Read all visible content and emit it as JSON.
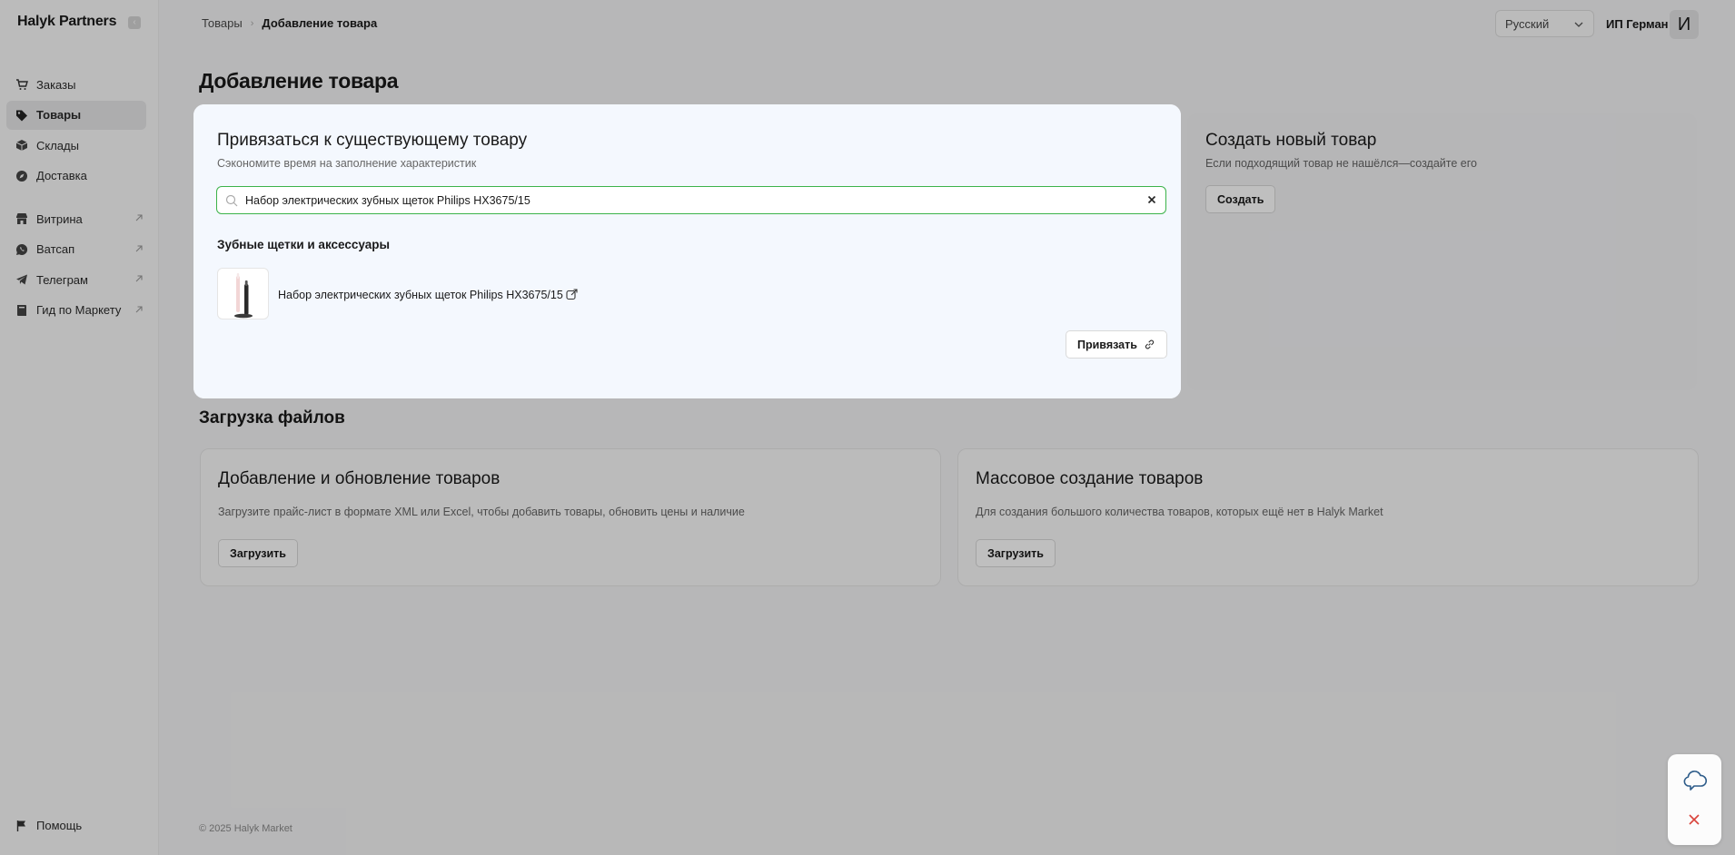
{
  "brand": "Halyk Partners",
  "collapse_icon_label": "‹",
  "nav": {
    "primary": [
      {
        "label": "Заказы",
        "icon": "cart-icon"
      },
      {
        "label": "Товары",
        "icon": "tag-icon",
        "active": true
      },
      {
        "label": "Склады",
        "icon": "box-icon"
      },
      {
        "label": "Доставка",
        "icon": "compass-icon"
      }
    ],
    "secondary": [
      {
        "label": "Витрина",
        "icon": "store-icon"
      },
      {
        "label": "Ватсап",
        "icon": "whatsapp-icon"
      },
      {
        "label": "Телеграм",
        "icon": "telegram-icon"
      },
      {
        "label": "Гид по Маркету",
        "icon": "book-icon"
      }
    ],
    "help": "Помощь"
  },
  "header": {
    "breadcrumb": {
      "parent": "Товары",
      "separator": "›",
      "current": "Добавление товара"
    },
    "language": "Русский",
    "user_name": "ИП Герман",
    "avatar_letter": "И"
  },
  "page_title": "Добавление товара",
  "link_card": {
    "title": "Привязаться к существующему товару",
    "subtitle": "Сэкономите время на заполнение характеристик",
    "search_value": "Набор электрических зубных щеток Philips HX3675/15",
    "category": "Зубные щетки и аксессуары",
    "result_title": "Набор электрических зубных щеток Philips HX3675/15",
    "link_button": "Привязать"
  },
  "create_card": {
    "title": "Создать новый товар",
    "subtitle": "Если подходящий товар не нашёлся—создайте его",
    "button": "Создать"
  },
  "uploads": {
    "section_title": "Загрузка файлов",
    "cards": [
      {
        "title": "Добавление и обновление товаров",
        "subtitle": "Загрузите прайс-лист в формате XML или Excel, чтобы добавить товары, обновить цены и наличие",
        "button": "Загрузить"
      },
      {
        "title": "Массовое создание товаров",
        "subtitle": "Для создания большого количества товаров, которых ещё нет в Halyk Market",
        "button": "Загрузить"
      }
    ]
  },
  "footer": "© 2025 Halyk Market",
  "colors": {
    "accent_green": "#3cb34a",
    "close_red": "#d9433b",
    "chat_blue": "#2f5d8a"
  }
}
